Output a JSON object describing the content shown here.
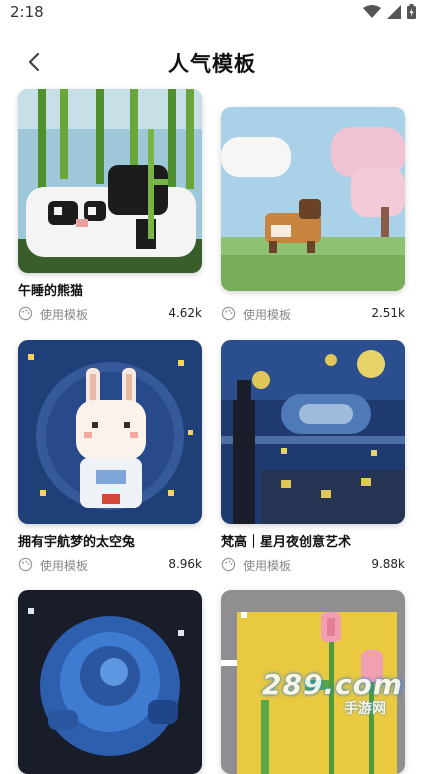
{
  "status_bar": {
    "time": "2:18"
  },
  "header": {
    "title": "人气模板"
  },
  "cards": [
    {
      "name": "午睡的熊猫",
      "use_label": "使用模板",
      "count": "4.62k"
    },
    {
      "name": "",
      "use_label": "使用模板",
      "count": "2.51k"
    },
    {
      "name": "拥有宇航梦的太空兔",
      "use_label": "使用模板",
      "count": "8.96k"
    },
    {
      "name": "梵高｜星月夜创意艺术",
      "use_label": "使用模板",
      "count": "9.88k"
    },
    {
      "name": "",
      "use_label": "",
      "count": ""
    },
    {
      "name": "",
      "use_label": "",
      "count": ""
    }
  ],
  "watermark": {
    "text": "289.com",
    "subtext": "手游网"
  }
}
